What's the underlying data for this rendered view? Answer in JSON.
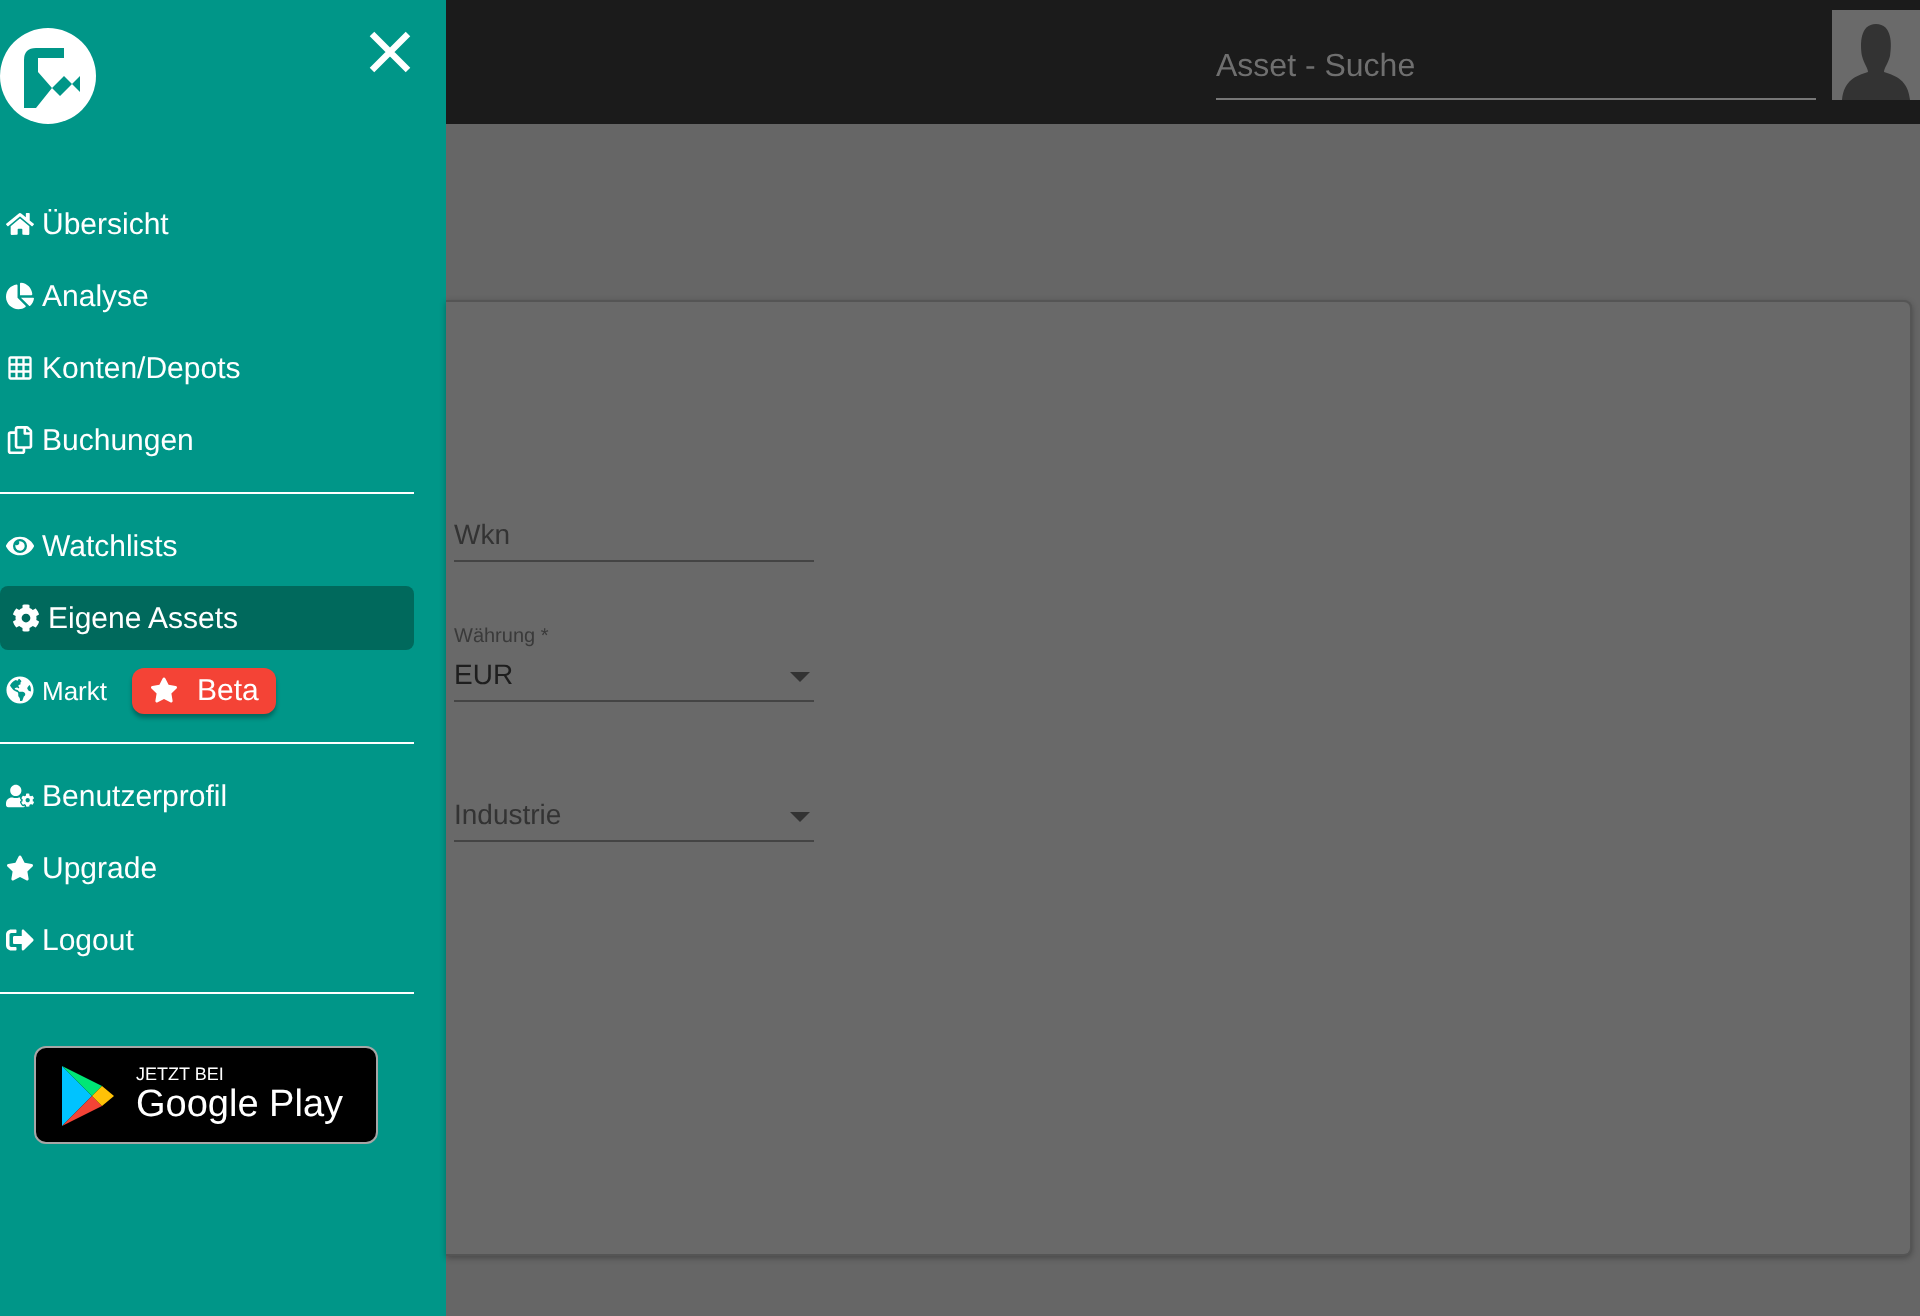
{
  "sidebar": {
    "groups": [
      {
        "items": [
          {
            "label": "Übersicht",
            "selected": false
          },
          {
            "label": "Analyse",
            "selected": false
          },
          {
            "label": "Konten/Depots",
            "selected": false
          },
          {
            "label": "Buchungen",
            "selected": false
          }
        ]
      },
      {
        "items": [
          {
            "label": "Watchlists",
            "selected": false
          },
          {
            "label": "Eigene Assets",
            "selected": true
          },
          {
            "label": "Markt",
            "selected": false,
            "badge": "Beta"
          }
        ]
      },
      {
        "items": [
          {
            "label": "Benutzerprofil",
            "selected": false
          },
          {
            "label": "Upgrade",
            "selected": false
          },
          {
            "label": "Logout",
            "selected": false
          }
        ]
      }
    ],
    "store_badge": {
      "caption": "JETZT BEI",
      "name": "Google Play"
    }
  },
  "header": {
    "search": {
      "placeholder": "Asset - Suche"
    }
  },
  "form": {
    "fields": [
      {
        "kind": "text",
        "placeholder": "Wkn"
      },
      {
        "kind": "select",
        "label": "Währung *",
        "value": "EUR"
      },
      {
        "kind": "select",
        "placeholder": "Industrie"
      }
    ]
  }
}
